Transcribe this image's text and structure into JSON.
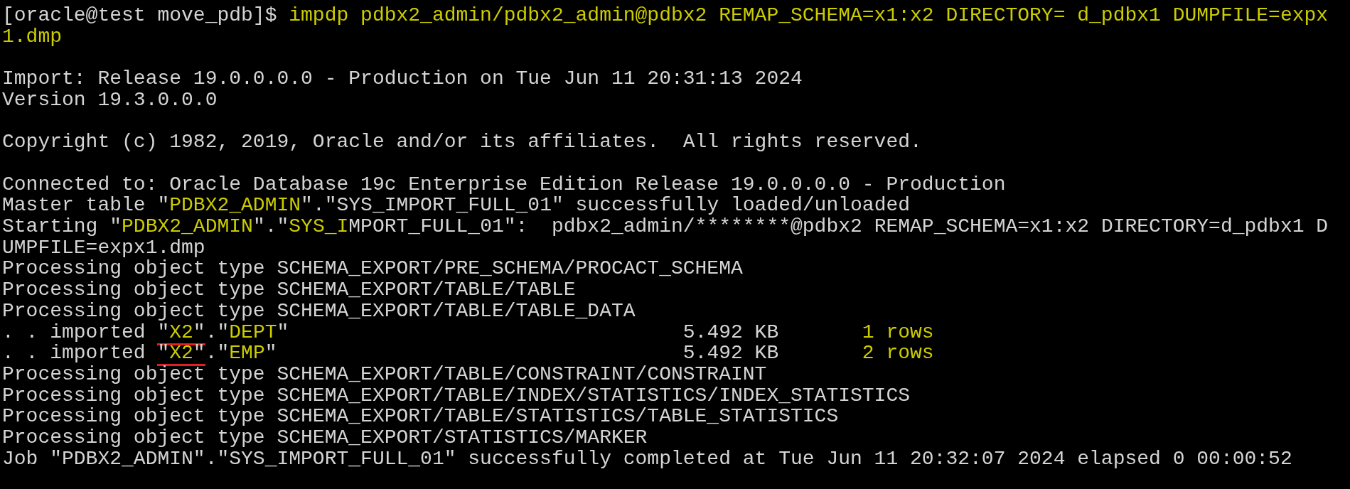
{
  "terminal": {
    "blocks": [
      [
        {
          "segments": [
            {
              "text": "[oracle@test move_pdb]$ ",
              "kind": "plain"
            },
            {
              "text": "impdp pdbx2_admin/pdbx2_admin@pdbx2 REMAP_SCHEMA=x1:x2 DIRECTORY= d_pdbx1 DUMPFILE=expx",
              "kind": "highlight"
            }
          ]
        },
        {
          "segments": [
            {
              "text": "1.dmp",
              "kind": "highlight"
            }
          ]
        }
      ],
      [
        {
          "segments": [
            {
              "text": "Import: Release 19.0.0.0.0 - Production on Tue Jun 11 20:31:13 2024",
              "kind": "plain"
            }
          ]
        },
        {
          "segments": [
            {
              "text": "Version 19.3.0.0.0",
              "kind": "plain"
            }
          ]
        }
      ],
      [
        {
          "segments": [
            {
              "text": "Copyright (c) 1982, 2019, Oracle and/or its affiliates.  All rights reserved.",
              "kind": "plain"
            }
          ]
        }
      ],
      [
        {
          "segments": [
            {
              "text": "Connected to: Oracle Database 19c Enterprise Edition Release 19.0.0.0.0 - Production",
              "kind": "plain"
            }
          ]
        },
        {
          "segments": [
            {
              "text": "Master table \"",
              "kind": "plain"
            },
            {
              "text": "PDBX2_ADMIN",
              "kind": "highlight"
            },
            {
              "text": "\".\"SYS_IMPORT_FULL_01\" successfully loaded/unloaded",
              "kind": "plain"
            }
          ]
        },
        {
          "segments": [
            {
              "text": "Starting \"",
              "kind": "plain"
            },
            {
              "text": "PDBX2_ADMIN",
              "kind": "highlight"
            },
            {
              "text": "\".\"",
              "kind": "plain"
            },
            {
              "text": "SYS_I",
              "kind": "highlight"
            },
            {
              "text": "MPORT_FULL_01\":  pdbx2_admin/********@pdbx2 REMAP_SCHEMA=x1:x2 DIRECTORY=d_pdbx1 D",
              "kind": "plain"
            }
          ]
        },
        {
          "segments": [
            {
              "text": "UMPFILE=expx1.dmp",
              "kind": "plain"
            }
          ]
        },
        {
          "segments": [
            {
              "text": "Processing object type SCHEMA_EXPORT/PRE_SCHEMA/PROCACT_SCHEMA",
              "kind": "plain"
            }
          ]
        },
        {
          "segments": [
            {
              "text": "Processing object type SCHEMA_EXPORT/TABLE/TABLE",
              "kind": "plain"
            }
          ]
        },
        {
          "segments": [
            {
              "text": "Processing object type SCHEMA_EXPORT/TABLE/TABLE_DATA",
              "kind": "plain"
            }
          ]
        },
        {
          "segments": [
            {
              "text": ". . imported ",
              "kind": "plain"
            },
            {
              "text": "\"",
              "kind": "plain",
              "underlined": true
            },
            {
              "text": "X2",
              "kind": "highlight",
              "underlined": true
            },
            {
              "text": "\"",
              "kind": "plain",
              "underlined": true
            },
            {
              "text": ".\"",
              "kind": "plain"
            },
            {
              "text": "DEPT",
              "kind": "highlight"
            },
            {
              "text": "\"                                 5.492 KB       ",
              "kind": "plain"
            },
            {
              "text": "1 rows",
              "kind": "highlight"
            }
          ]
        },
        {
          "segments": [
            {
              "text": ". . imported ",
              "kind": "plain"
            },
            {
              "text": "\"",
              "kind": "plain",
              "underlined": true
            },
            {
              "text": "X2",
              "kind": "highlight",
              "underlined": true
            },
            {
              "text": "\"",
              "kind": "plain",
              "underlined": true
            },
            {
              "text": ".\"",
              "kind": "plain"
            },
            {
              "text": "EMP",
              "kind": "highlight"
            },
            {
              "text": "\"                                  5.492 KB       ",
              "kind": "plain"
            },
            {
              "text": "2 rows",
              "kind": "highlight"
            }
          ]
        },
        {
          "segments": [
            {
              "text": "Processing object type SCHEMA_EXPORT/TABLE/CONSTRAINT/CONSTRAINT",
              "kind": "plain"
            }
          ]
        },
        {
          "segments": [
            {
              "text": "Processing object type SCHEMA_EXPORT/TABLE/INDEX/STATISTICS/INDEX_STATISTICS",
              "kind": "plain"
            }
          ]
        },
        {
          "segments": [
            {
              "text": "Processing object type SCHEMA_EXPORT/TABLE/STATISTICS/TABLE_STATISTICS",
              "kind": "plain"
            }
          ]
        },
        {
          "segments": [
            {
              "text": "Processing object type SCHEMA_EXPORT/STATISTICS/MARKER",
              "kind": "plain"
            }
          ]
        },
        {
          "segments": [
            {
              "text": "Job \"PDBX2_ADMIN\".\"SYS_IMPORT_FULL_01\" successfully completed at Tue Jun 11 20:32:07 2024 elapsed 0 00:00:52",
              "kind": "plain"
            }
          ]
        }
      ]
    ]
  }
}
